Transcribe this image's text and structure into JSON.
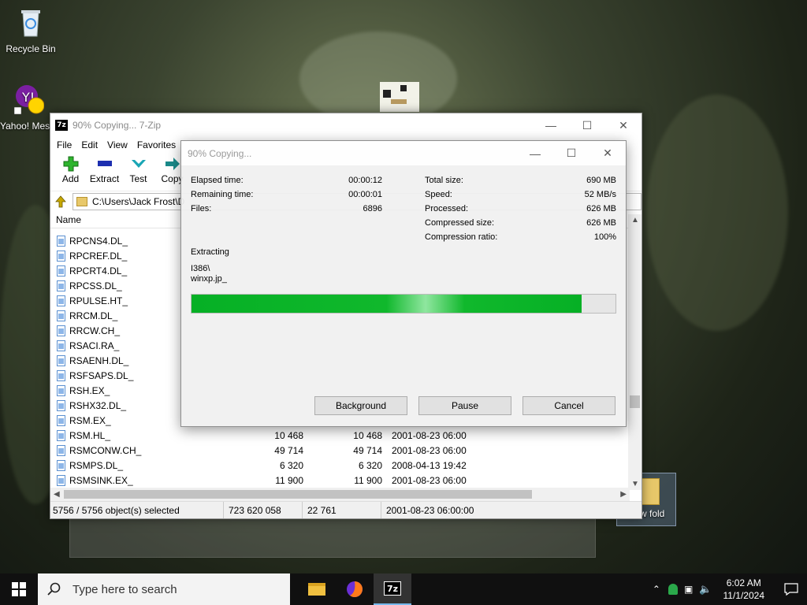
{
  "desktop": {
    "icons": [
      {
        "label": "Recycle Bin"
      },
      {
        "label": "Yahoo! Messenger"
      },
      {
        "label": "New fold"
      }
    ]
  },
  "zip_window": {
    "title": "90% Copying... 7-Zip",
    "menu": [
      "File",
      "Edit",
      "View",
      "Favorites"
    ],
    "toolbar": [
      {
        "label": "Add",
        "icon": "plus-icon",
        "color": "#2db42d"
      },
      {
        "label": "Extract",
        "icon": "minus-icon",
        "color": "#1d2fb0"
      },
      {
        "label": "Test",
        "icon": "check-icon",
        "color": "#1aa6b5"
      },
      {
        "label": "Copy",
        "icon": "arrow-right-icon",
        "color": "#1a8a8a"
      }
    ],
    "address": "C:\\Users\\Jack Frost\\D",
    "column_name": "Name",
    "files": [
      {
        "name": "RPCNS4.DL_",
        "size": "",
        "packed": "",
        "modified": ""
      },
      {
        "name": "RPCREF.DL_",
        "size": "",
        "packed": "",
        "modified": ""
      },
      {
        "name": "RPCRT4.DL_",
        "size": "",
        "packed": "",
        "modified": ""
      },
      {
        "name": "RPCSS.DL_",
        "size": "",
        "packed": "",
        "modified": ""
      },
      {
        "name": "RPULSE.HT_",
        "size": "",
        "packed": "",
        "modified": ""
      },
      {
        "name": "RRCM.DL_",
        "size": "",
        "packed": "",
        "modified": ""
      },
      {
        "name": "RRCW.CH_",
        "size": "",
        "packed": "",
        "modified": ""
      },
      {
        "name": "RSACI.RA_",
        "size": "",
        "packed": "",
        "modified": ""
      },
      {
        "name": "RSAENH.DL_",
        "size": "",
        "packed": "",
        "modified": ""
      },
      {
        "name": "RSFSAPS.DL_",
        "size": "",
        "packed": "",
        "modified": ""
      },
      {
        "name": "RSH.EX_",
        "size": "",
        "packed": "",
        "modified": ""
      },
      {
        "name": "RSHX32.DL_",
        "size": "",
        "packed": "",
        "modified": ""
      },
      {
        "name": "RSM.EX_",
        "size": "",
        "packed": "",
        "modified": ""
      },
      {
        "name": "RSM.HL_",
        "size": "10 468",
        "packed": "10 468",
        "modified": "2001-08-23 06:00"
      },
      {
        "name": "RSMCONW.CH_",
        "size": "49 714",
        "packed": "49 714",
        "modified": "2001-08-23 06:00"
      },
      {
        "name": "RSMPS.DL_",
        "size": "6 320",
        "packed": "6 320",
        "modified": "2008-04-13 19:42"
      },
      {
        "name": "RSMSINK.EX_",
        "size": "11 900",
        "packed": "11 900",
        "modified": "2001-08-23 06:00"
      }
    ],
    "status": {
      "selected": "5756 / 5756 object(s) selected",
      "total": "723 620 058",
      "item": "22 761",
      "date": "2001-08-23 06:00:00"
    }
  },
  "progress_dialog": {
    "title": "90% Copying...",
    "left_stats": [
      {
        "label": "Elapsed time:",
        "value": "00:00:12"
      },
      {
        "label": "Remaining time:",
        "value": "00:00:01"
      },
      {
        "label": "Files:",
        "value": "6896"
      }
    ],
    "right_stats": [
      {
        "label": "Total size:",
        "value": "690 MB"
      },
      {
        "label": "Speed:",
        "value": "52 MB/s"
      },
      {
        "label": "Processed:",
        "value": "626 MB"
      },
      {
        "label": "Compressed size:",
        "value": "626 MB"
      },
      {
        "label": "Compression ratio:",
        "value": "100%"
      }
    ],
    "operation": "Extracting",
    "path": "I386\\",
    "current_file": "winxp.jp_",
    "progress_fraction": 0.92,
    "progress_color": "#06b025",
    "buttons": {
      "background": "Background",
      "pause": "Pause",
      "cancel": "Cancel"
    }
  },
  "taskbar": {
    "search_placeholder": "Type here to search",
    "time": "6:02 AM",
    "date": "11/1/2024"
  }
}
